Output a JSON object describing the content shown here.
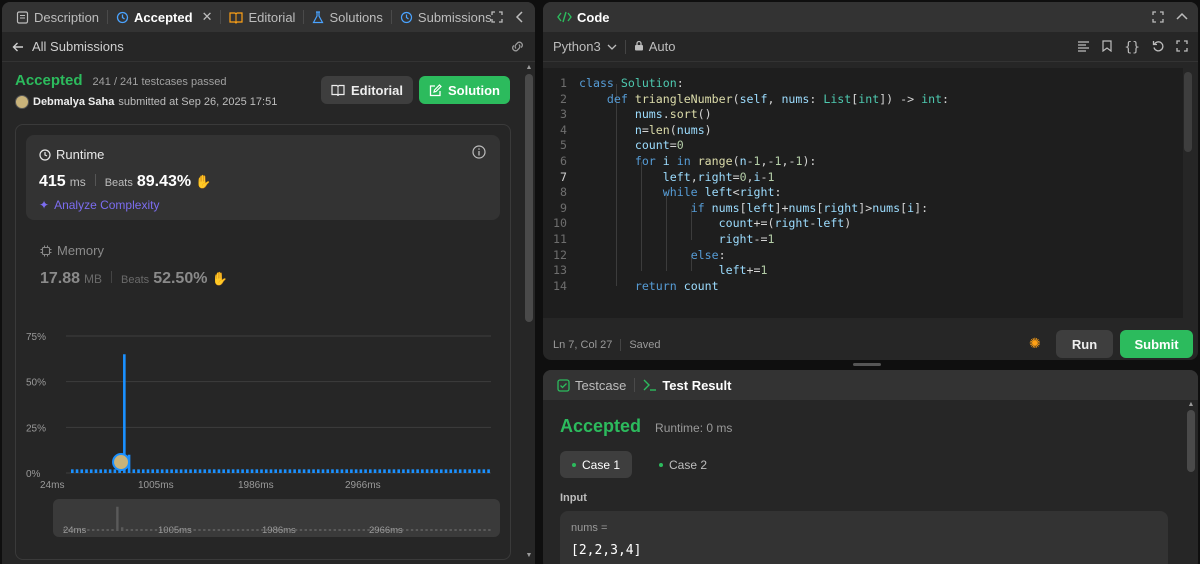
{
  "left_tabs": {
    "description": "Description",
    "accepted": "Accepted",
    "editorial": "Editorial",
    "solutions": "Solutions",
    "submissions": "Submissions"
  },
  "submission": {
    "back_label": "All Submissions",
    "status": "Accepted",
    "testcases": "241 / 241 testcases passed",
    "user": "Debmalya Saha",
    "submitted": "submitted at Sep 26, 2025 17:51",
    "editorial_btn": "Editorial",
    "solution_btn": "Solution"
  },
  "runtime": {
    "title": "Runtime",
    "value": "415",
    "unit": "ms",
    "beats_label": "Beats",
    "beats": "89.43%",
    "analyze": "Analyze Complexity"
  },
  "memory": {
    "title": "Memory",
    "value": "17.88",
    "unit": "MB",
    "beats_label": "Beats",
    "beats": "52.50%"
  },
  "chart_data": {
    "type": "bar",
    "y_ticks": [
      "75%",
      "50%",
      "25%",
      "0%"
    ],
    "ylim": [
      0,
      75
    ],
    "x_ticks": [
      "24ms",
      "1005ms",
      "1986ms",
      "2966ms"
    ],
    "xlim": [
      24,
      3300
    ],
    "values": [
      2,
      2,
      2,
      2,
      2,
      2,
      2,
      2,
      2,
      2,
      2,
      65,
      10,
      2,
      2,
      2,
      2,
      2,
      2,
      2,
      2,
      2,
      2,
      2,
      2,
      2,
      2,
      2,
      2,
      2,
      2,
      2,
      2,
      2,
      2,
      2,
      2,
      2,
      2,
      2,
      2,
      2,
      2,
      2,
      2,
      2,
      2,
      2,
      2,
      2,
      2,
      2,
      2,
      2,
      2,
      2,
      2,
      2,
      2,
      2,
      2,
      2,
      2,
      2,
      2,
      2,
      2,
      2,
      2,
      2,
      2,
      2,
      2,
      2,
      2,
      2,
      2,
      2,
      2,
      2,
      2,
      2,
      2,
      2,
      2,
      2,
      2,
      2,
      2
    ],
    "highlight_index": 11,
    "bar_color": "#1a90ff",
    "grid": true
  },
  "code_header": {
    "title": "Code",
    "language": "Python3",
    "mode": "Auto"
  },
  "code_lines": [
    [
      [
        "kw",
        "class "
      ],
      [
        "cls",
        "Solution"
      ],
      [
        "op",
        ":"
      ]
    ],
    [
      [
        "op",
        "    "
      ],
      [
        "kw",
        "def "
      ],
      [
        "fn",
        "triangleNumber"
      ],
      [
        "op",
        "("
      ],
      [
        "var",
        "self"
      ],
      [
        "op",
        ", "
      ],
      [
        "var",
        "nums"
      ],
      [
        "op",
        ": "
      ],
      [
        "cls",
        "List"
      ],
      [
        "op",
        "["
      ],
      [
        "cls",
        "int"
      ],
      [
        "op",
        "]) -> "
      ],
      [
        "cls",
        "int"
      ],
      [
        "op",
        ":"
      ]
    ],
    [
      [
        "op",
        "        "
      ],
      [
        "var",
        "nums"
      ],
      [
        "op",
        "."
      ],
      [
        "fn",
        "sort"
      ],
      [
        "op",
        "()"
      ]
    ],
    [
      [
        "op",
        "        "
      ],
      [
        "var",
        "n"
      ],
      [
        "op",
        "="
      ],
      [
        "fn",
        "len"
      ],
      [
        "op",
        "("
      ],
      [
        "var",
        "nums"
      ],
      [
        "op",
        ")"
      ]
    ],
    [
      [
        "op",
        "        "
      ],
      [
        "var",
        "count"
      ],
      [
        "op",
        "="
      ],
      [
        "num",
        "0"
      ]
    ],
    [
      [
        "op",
        "        "
      ],
      [
        "kw",
        "for "
      ],
      [
        "var",
        "i "
      ],
      [
        "kw",
        "in "
      ],
      [
        "fn",
        "range"
      ],
      [
        "op",
        "("
      ],
      [
        "var",
        "n"
      ],
      [
        "op",
        "-"
      ],
      [
        "num",
        "1"
      ],
      [
        "op",
        ",-"
      ],
      [
        "num",
        "1"
      ],
      [
        "op",
        ",-"
      ],
      [
        "num",
        "1"
      ],
      [
        "op",
        "):"
      ]
    ],
    [
      [
        "op",
        "            "
      ],
      [
        "var",
        "left"
      ],
      [
        "op",
        ","
      ],
      [
        "var",
        "right"
      ],
      [
        "op",
        "="
      ],
      [
        "num",
        "0"
      ],
      [
        "op",
        ","
      ],
      [
        "var",
        "i"
      ],
      [
        "op",
        "-"
      ],
      [
        "num",
        "1"
      ]
    ],
    [
      [
        "op",
        "            "
      ],
      [
        "kw",
        "while "
      ],
      [
        "var",
        "left"
      ],
      [
        "op",
        "<"
      ],
      [
        "var",
        "right"
      ],
      [
        "op",
        ":"
      ]
    ],
    [
      [
        "op",
        "                "
      ],
      [
        "kw",
        "if "
      ],
      [
        "var",
        "nums"
      ],
      [
        "op",
        "["
      ],
      [
        "var",
        "left"
      ],
      [
        "op",
        "]+"
      ],
      [
        "var",
        "nums"
      ],
      [
        "op",
        "["
      ],
      [
        "var",
        "right"
      ],
      [
        "op",
        "]>"
      ],
      [
        "var",
        "nums"
      ],
      [
        "op",
        "["
      ],
      [
        "var",
        "i"
      ],
      [
        "op",
        "]:"
      ]
    ],
    [
      [
        "op",
        "                    "
      ],
      [
        "var",
        "count"
      ],
      [
        "op",
        "+=("
      ],
      [
        "var",
        "right"
      ],
      [
        "op",
        "-"
      ],
      [
        "var",
        "left"
      ],
      [
        "op",
        ")"
      ]
    ],
    [
      [
        "op",
        "                    "
      ],
      [
        "var",
        "right"
      ],
      [
        "op",
        "-="
      ],
      [
        "num",
        "1"
      ]
    ],
    [
      [
        "op",
        "                "
      ],
      [
        "kw",
        "else"
      ],
      [
        "op",
        ":"
      ]
    ],
    [
      [
        "op",
        "                    "
      ],
      [
        "var",
        "left"
      ],
      [
        "op",
        "+="
      ],
      [
        "num",
        "1"
      ]
    ],
    [
      [
        "op",
        "        "
      ],
      [
        "kw",
        "return "
      ],
      [
        "var",
        "count"
      ]
    ]
  ],
  "line_numbers": [
    "1",
    "2",
    "3",
    "4",
    "5",
    "6",
    "7",
    "8",
    "9",
    "10",
    "11",
    "12",
    "13",
    "14"
  ],
  "status_bar": {
    "position": "Ln 7, Col 27",
    "saved": "Saved",
    "run": "Run",
    "submit": "Submit"
  },
  "test_tabs": {
    "testcase": "Testcase",
    "result": "Test Result"
  },
  "test_result": {
    "status": "Accepted",
    "runtime": "Runtime: 0 ms",
    "case1": "Case 1",
    "case2": "Case 2",
    "input_label": "Input",
    "var_name": "nums =",
    "var_value": "[2,2,3,4]"
  }
}
